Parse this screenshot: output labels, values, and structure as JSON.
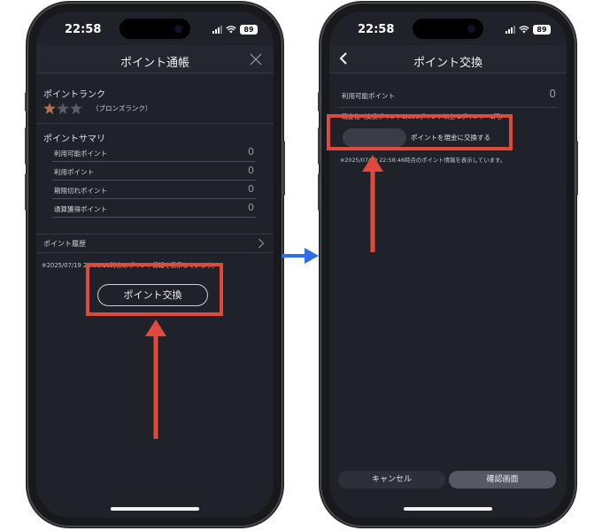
{
  "colors": {
    "highlight": "#e14a3b",
    "flow_arrow": "#2f6ee6",
    "star_filled": "#b5724a",
    "star_empty": "#5a5d68",
    "background": "#20222a"
  },
  "left_phone": {
    "status": {
      "time": "22:58",
      "battery": "89"
    },
    "nav": {
      "title": "ポイント通帳",
      "close_icon": "close-icon"
    },
    "rank": {
      "heading": "ポイントランク",
      "stars_filled": 1,
      "stars_total": 3,
      "label": "（ブロンズランク）"
    },
    "summary": {
      "heading": "ポイントサマリ",
      "rows": [
        {
          "label": "利用可能ポイント",
          "value": "0"
        },
        {
          "label": "利用ポイント",
          "value": "0"
        },
        {
          "label": "期限切れポイント",
          "value": "0"
        },
        {
          "label": "通算獲得ポイント",
          "value": "0"
        }
      ]
    },
    "history": {
      "label": "ポイント履歴",
      "chevron_icon": "chevron-right-icon"
    },
    "note": "※2025/07/19 22:58:38時点のポイント情報を表示しています。",
    "exchange_button": "ポイント交換"
  },
  "right_phone": {
    "status": {
      "time": "22:58",
      "battery": "89"
    },
    "nav": {
      "title": "ポイント交換",
      "back_icon": "chevron-left-icon"
    },
    "available": {
      "label": "利用可能ポイント",
      "value": "0"
    },
    "rate": "現金化（交換ポイント1,000ポイント以上 1ポイント=1円）",
    "exchange_text": "ポイントを現金に交換する",
    "note": "※2025/07/19 22:58:46時点のポイント情報を表示しています。",
    "cancel_button": "キャンセル",
    "confirm_button": "確認画面"
  }
}
